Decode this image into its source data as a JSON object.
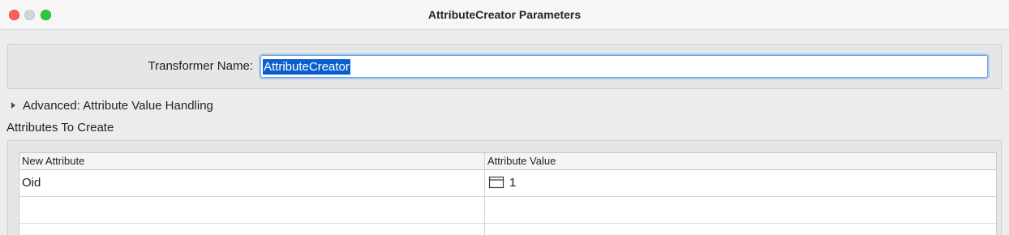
{
  "window": {
    "title": "AttributeCreator Parameters"
  },
  "transformer": {
    "label": "Transformer Name:",
    "value": "AttributeCreator"
  },
  "advanced": {
    "label": "Advanced: Attribute Value Handling",
    "expanded": false
  },
  "attributes_section": {
    "title": "Attributes To Create"
  },
  "table": {
    "columns": [
      "New Attribute",
      "Attribute Value"
    ],
    "rows": [
      {
        "name": "Oid",
        "value": "1",
        "value_icon": "text-value-icon"
      },
      {
        "name": "",
        "value": ""
      }
    ]
  },
  "colors": {
    "close": "#fe5f57",
    "minimize": "#d4d4d4",
    "maximize": "#2ac840",
    "selection": "#0a5fcf",
    "focus_ring": "#6fa6e8"
  }
}
